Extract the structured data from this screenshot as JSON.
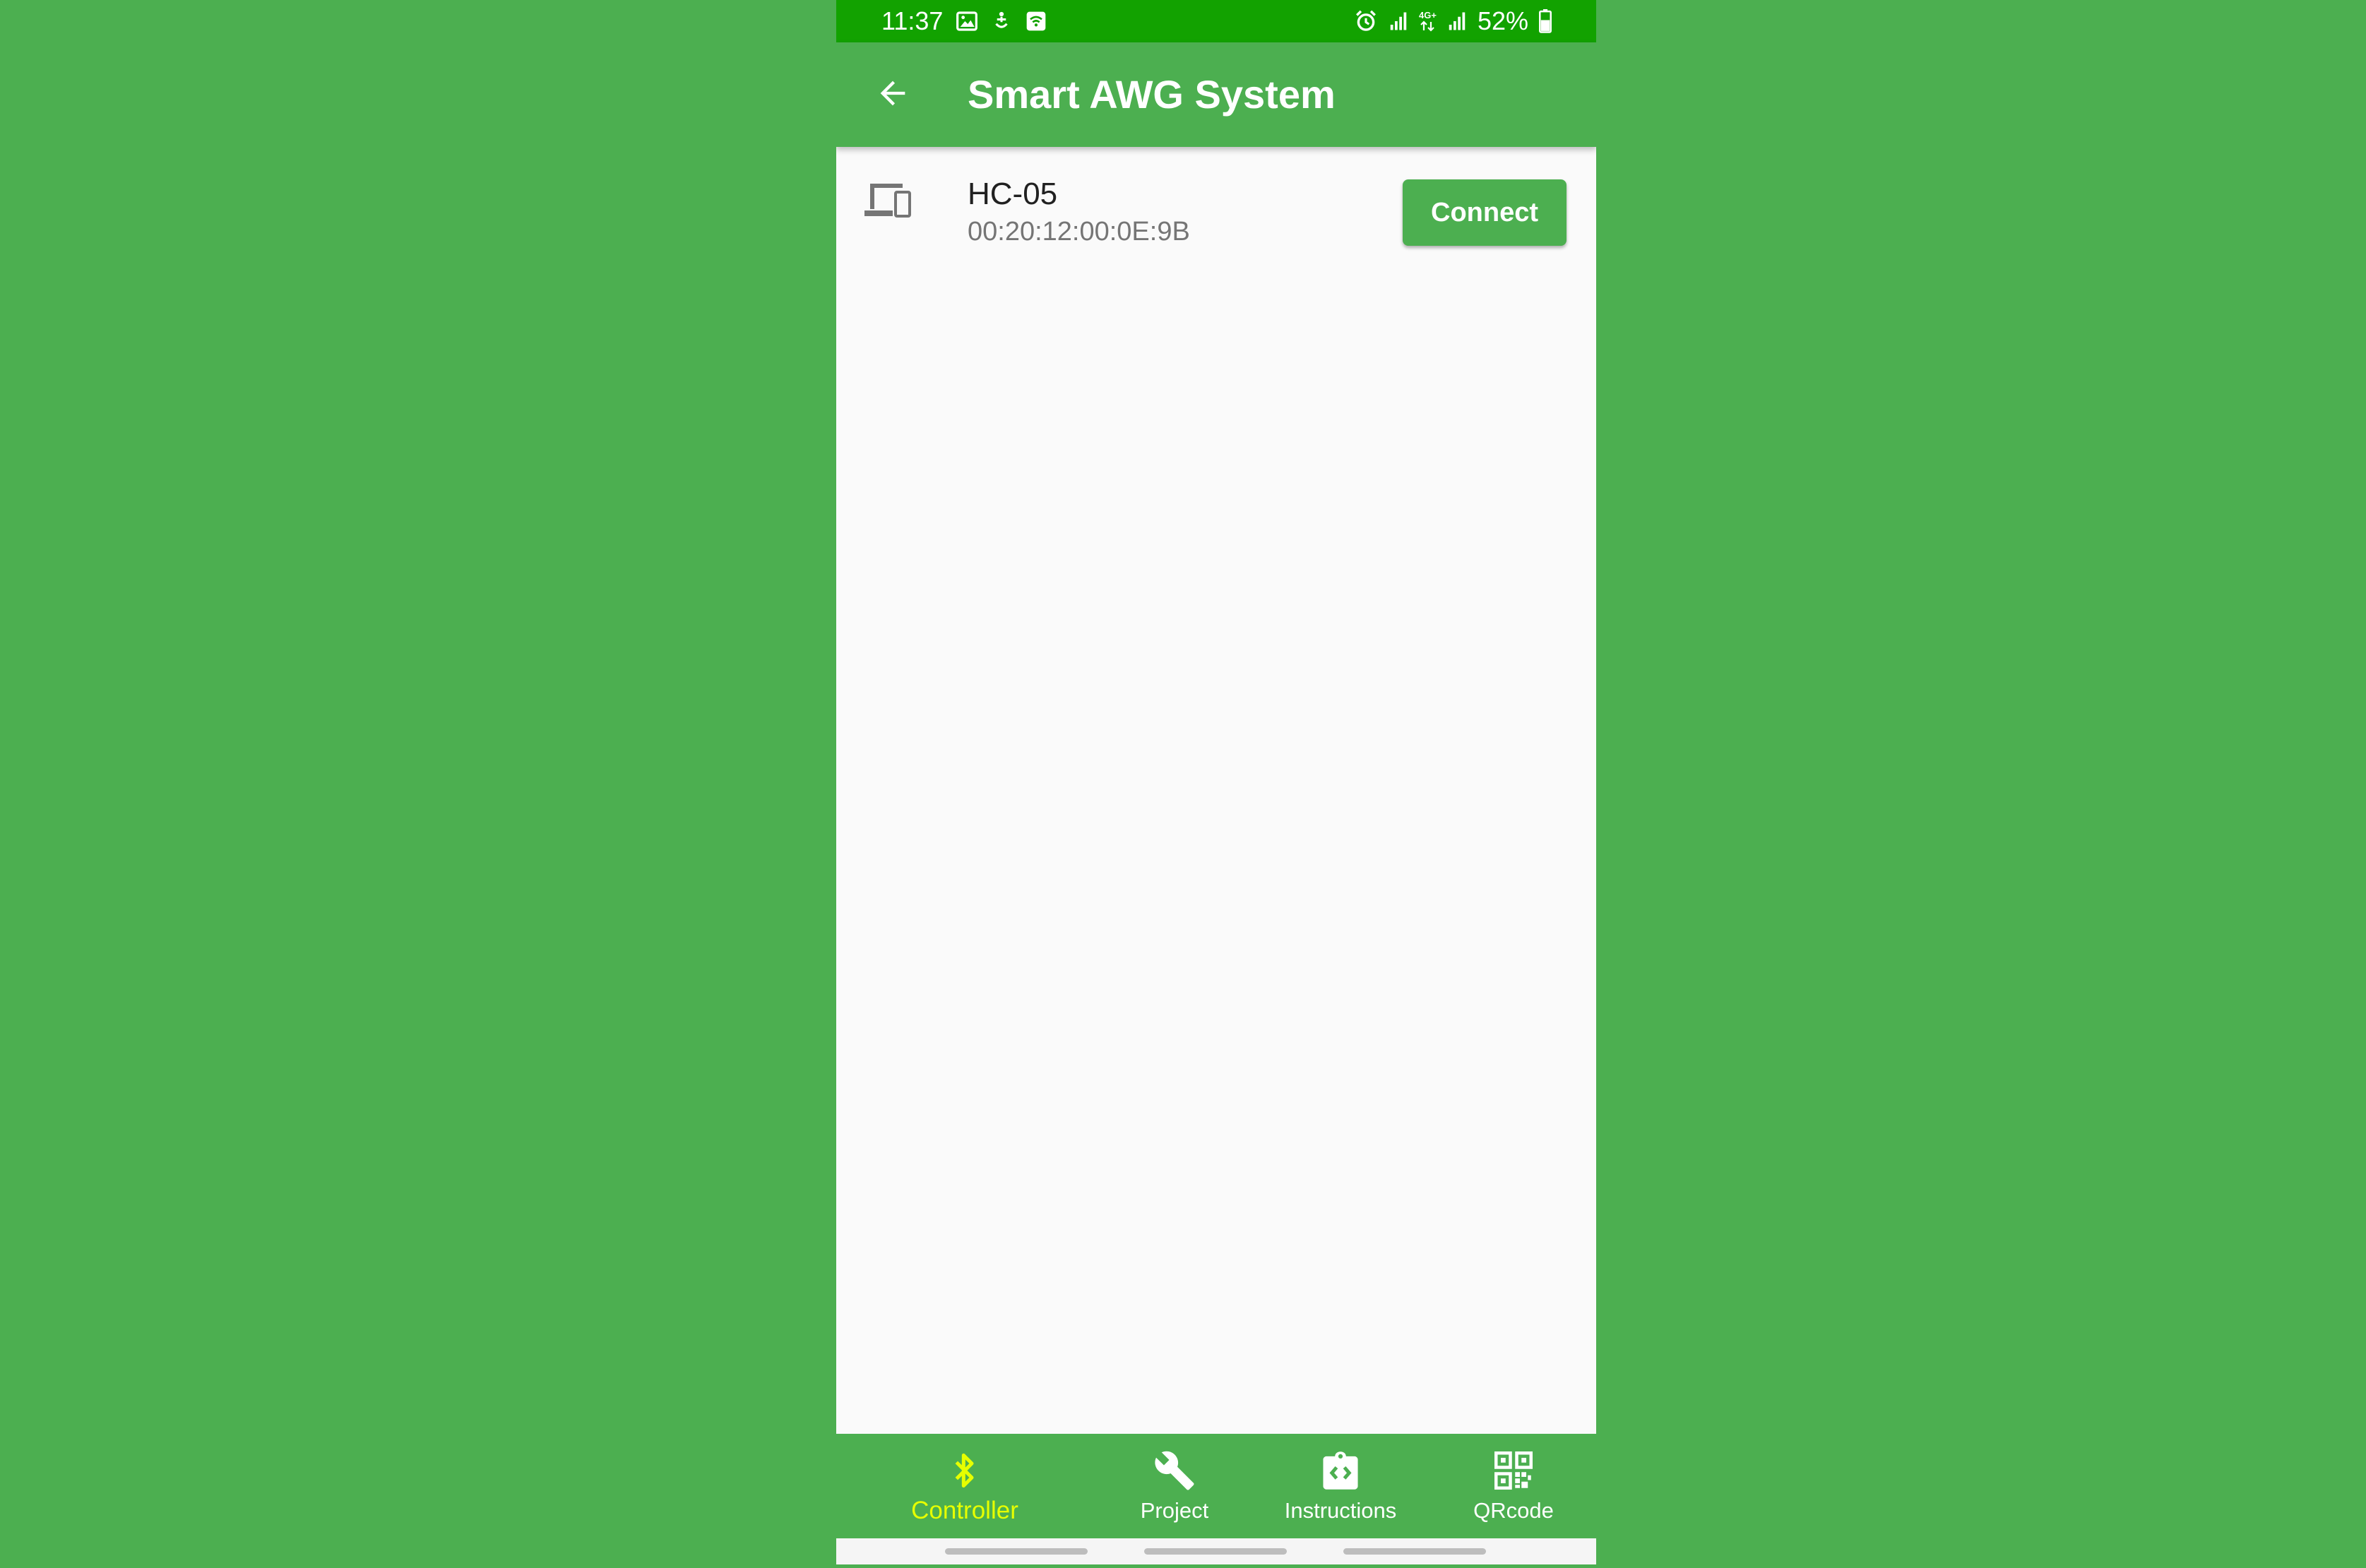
{
  "status_bar": {
    "time": "11:37",
    "battery": "52%",
    "left_icons": [
      "gallery-icon",
      "accessibility-icon",
      "wifi-calling-icon"
    ],
    "right_icons": [
      "alarm-icon",
      "signal-icon",
      "network-4g-icon",
      "signal-icon",
      "battery-icon"
    ],
    "network_label": "4G+"
  },
  "app_bar": {
    "title": "Smart AWG System",
    "back_icon": "arrow-back-icon"
  },
  "devices": [
    {
      "icon": "devices-icon",
      "name": "HC-05",
      "address": "00:20:12:00:0E:9B",
      "action_label": "Connect"
    }
  ],
  "bottom_nav": {
    "items": [
      {
        "label": "Controller",
        "icon": "bluetooth-icon",
        "active": true
      },
      {
        "label": "Project",
        "icon": "wrench-icon",
        "active": false
      },
      {
        "label": "Instructions",
        "icon": "code-clipboard-icon",
        "active": false
      },
      {
        "label": "QRcode",
        "icon": "qr-code-icon",
        "active": false
      }
    ]
  },
  "colors": {
    "background": "#4caf50",
    "status_bar": "#12a200",
    "app_bar": "#4caf50",
    "active_nav": "#e6ff00",
    "content_bg": "#fafafa"
  }
}
